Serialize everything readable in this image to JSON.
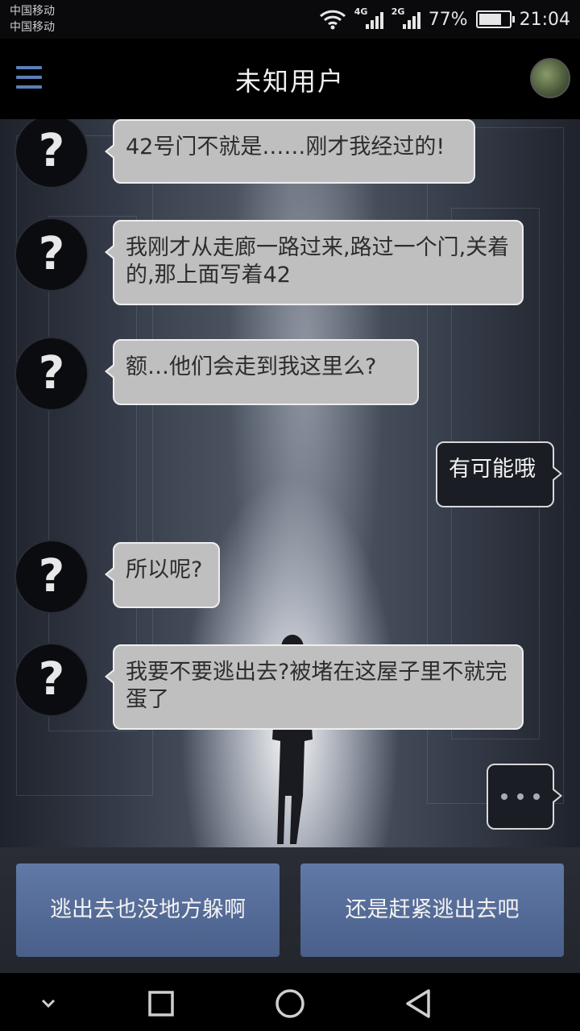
{
  "status_bar": {
    "carrier_1": "中国移动",
    "carrier_2": "中国移动",
    "network_1": "4G",
    "network_2": "2G",
    "battery_text": "77%",
    "battery_level": 0.77,
    "time": "21:04"
  },
  "header": {
    "title": "未知用户",
    "menu_icon": "hamburger-menu-icon",
    "avatar_icon": "user-avatar-photo"
  },
  "messages": [
    {
      "side": "left",
      "text": "42号门不就是……刚才我经过的!"
    },
    {
      "side": "left",
      "text": "我刚才从走廊一路过来,路过一个门,关着的,那上面写着42"
    },
    {
      "side": "left",
      "text": "额…他们会走到我这里么?"
    },
    {
      "side": "right",
      "text": "有可能哦"
    },
    {
      "side": "left",
      "text": "所以呢?"
    },
    {
      "side": "left",
      "text": "我要不要逃出去?被堵在这屋子里不就完蛋了"
    },
    {
      "side": "right",
      "typing": true
    }
  ],
  "avatar_glyph": "?",
  "choices": [
    {
      "label": "逃出去也没地方躲啊"
    },
    {
      "label": "还是赶紧逃出去吧"
    }
  ],
  "nav": {
    "down_icon": "chevron-down-icon",
    "recent_icon": "square-icon",
    "home_icon": "circle-icon",
    "back_icon": "triangle-back-icon"
  },
  "colors": {
    "accent": "#5b7fb8",
    "choice_button": "#5a6f98",
    "bubble_received": "#bfbfbf",
    "bubble_sent": "#1b1d24"
  }
}
